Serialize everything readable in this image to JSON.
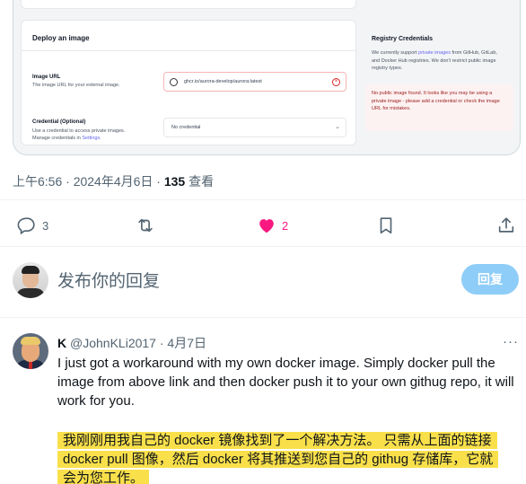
{
  "embed": {
    "deploy_title": "Deploy an image",
    "image_url_label": "Image URL",
    "image_url_help": "The image URL for your external image.",
    "image_url_value": "ghcr.io/aurora-develop/aurora:latest",
    "credential_label": "Credential (Optional)",
    "credential_help_1": "Use a credential to access private images.",
    "credential_help_2": "Manage credentials in ",
    "credential_help_link": "Settings.",
    "credential_value": "No credential",
    "registry_title": "Registry Credentials",
    "registry_text_1": "We currently support ",
    "registry_text_link": "private images",
    "registry_text_2": " from GitHub, GitLab, and Docker Hub registries. We don't restrict public image registry types.",
    "warning": "No public image found. It looks like you may be using a private image - please add a credential or check the image URL for mistakes."
  },
  "tweet": {
    "time": "上午6:56 · 2024年4月6日 · ",
    "views_count": "135",
    "views_label": " 查看"
  },
  "actions": {
    "reply_count": "3",
    "like_count": "2",
    "like_color": "#f91880"
  },
  "composer": {
    "placeholder": "发布你的回复",
    "button": "回复"
  },
  "reply": {
    "name": "K",
    "handle": " @JohnKLi2017 · 4月7日",
    "more": "···",
    "text": "I just got a workaround with my own docker image. Simply docker pull the image from above link and then docker push it to your own githug repo, it will work for you.",
    "translation": "我刚刚用我自己的 docker 镜像找到了一个解决方法。 只需从上面的链接 docker pull 图像，然后 docker 将其推送到您自己的 githug 存储库，它就会为您工作。",
    "highlight_color": "#f9e04b"
  }
}
